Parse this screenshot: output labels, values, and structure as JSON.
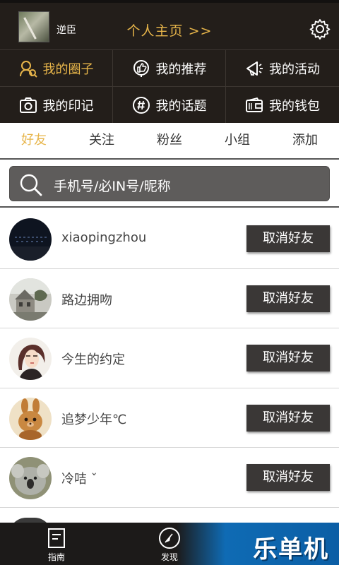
{
  "header": {
    "username": "逆臣",
    "homepage_link": "个人主页 >>",
    "settings_icon": "gear-icon"
  },
  "menu": {
    "items": [
      {
        "label": "我的圈子",
        "icon": "circle-users-icon",
        "active": true
      },
      {
        "label": "我的推荐",
        "icon": "thumbs-up-icon",
        "active": false
      },
      {
        "label": "我的活动",
        "icon": "megaphone-icon",
        "active": false
      },
      {
        "label": "我的印记",
        "icon": "camera-icon",
        "active": false
      },
      {
        "label": "我的话题",
        "icon": "hashtag-icon",
        "active": false
      },
      {
        "label": "我的钱包",
        "icon": "wallet-icon",
        "active": false
      }
    ]
  },
  "tabs": [
    {
      "label": "好友",
      "active": true
    },
    {
      "label": "关注",
      "active": false
    },
    {
      "label": "粉丝",
      "active": false
    },
    {
      "label": "小组",
      "active": false
    },
    {
      "label": "添加",
      "active": false
    }
  ],
  "search": {
    "placeholder": "手机号/必IN号/昵称"
  },
  "friends": [
    {
      "name": "xiaopingzhou",
      "button": "取消好友"
    },
    {
      "name": "路边拥吻",
      "button": "取消好友"
    },
    {
      "name": "今生的约定",
      "button": "取消好友"
    },
    {
      "name": "追梦少年℃",
      "button": "取消好友"
    },
    {
      "name": "冷咭 ˇ",
      "button": "取消好友"
    }
  ],
  "bottom_nav": {
    "items": [
      {
        "label": "指南",
        "icon": "guide-icon"
      },
      {
        "label": "发现",
        "icon": "compass-icon"
      }
    ],
    "watermark": "乐单机"
  },
  "colors": {
    "accent": "#e7b54a",
    "header_bg": "#231e1a",
    "button_bg": "#3a3736",
    "search_bg": "#5e5c5b"
  }
}
